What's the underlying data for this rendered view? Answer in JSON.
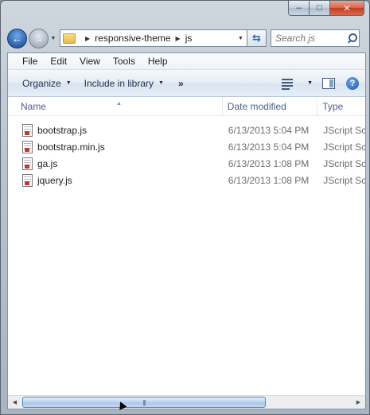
{
  "titlebar": {
    "minimize_glyph": "–",
    "maximize_glyph": "□",
    "close_glyph": "✕"
  },
  "nav": {
    "back_glyph": "←",
    "forward_glyph": "→",
    "breadcrumbs": [
      "responsive-theme",
      "js"
    ],
    "search_placeholder": "Search js",
    "refresh_glyph": "⇆"
  },
  "menubar": {
    "items": [
      "File",
      "Edit",
      "View",
      "Tools",
      "Help"
    ]
  },
  "toolbar": {
    "organize_label": "Organize",
    "include_label": "Include in library",
    "more_label": "»",
    "help_label": "?"
  },
  "columns": {
    "name": "Name",
    "date": "Date modified",
    "type": "Type"
  },
  "files": [
    {
      "name": "bootstrap.js",
      "date": "6/13/2013 5:04 PM",
      "type": "JScript Script File"
    },
    {
      "name": "bootstrap.min.js",
      "date": "6/13/2013 5:04 PM",
      "type": "JScript Script File"
    },
    {
      "name": "ga.js",
      "date": "6/13/2013 1:08 PM",
      "type": "JScript Script File"
    },
    {
      "name": "jquery.js",
      "date": "6/13/2013 1:08 PM",
      "type": "JScript Script File"
    }
  ],
  "icons": {
    "back": "back-arrow-icon",
    "forward": "forward-arrow-icon",
    "folder": "folder-icon",
    "search": "search-icon",
    "file": "jscript-file-icon",
    "views": "view-options-icon",
    "preview": "preview-pane-icon",
    "help": "help-icon"
  },
  "colors": {
    "accent": "#2a5fa8",
    "header_text": "#4d6185",
    "meta_text": "#6d6d6d"
  }
}
